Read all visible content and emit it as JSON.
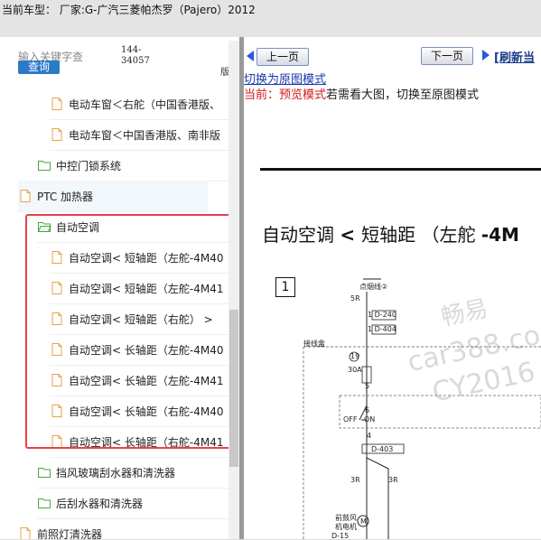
{
  "header": {
    "title": "当前车型： 厂家:G-广汽三菱帕杰罗（Pajero）2012"
  },
  "search": {
    "placeholder": "输入关键字查",
    "button_label": "查询",
    "code_line1": "144-",
    "code_line2": "34057",
    "code_mark": "版"
  },
  "tree": [
    {
      "label": "电动车窗＜右舵（中国香港版、",
      "type": "file"
    },
    {
      "label": "电动车窗＜中国香港版、南非版",
      "type": "file"
    },
    {
      "label": "中控门锁系统",
      "type": "folder"
    },
    {
      "label": "PTC 加热器",
      "type": "file"
    },
    {
      "label": "自动空调",
      "type": "folder-open"
    },
    {
      "label": "自动空调< 短轴距（左舵-4M40",
      "type": "file"
    },
    {
      "label": "自动空调< 短轴距（左舵-4M41",
      "type": "file"
    },
    {
      "label": "自动空调< 短轴距（右舵） >",
      "type": "file"
    },
    {
      "label": "自动空调< 长轴距（左舵-4M40",
      "type": "file"
    },
    {
      "label": "自动空调< 长轴距（左舵-4M41",
      "type": "file"
    },
    {
      "label": "自动空调< 长轴距（右舵-4M40",
      "type": "file"
    },
    {
      "label": "自动空调< 长轴距（右舵-4M41",
      "type": "file"
    },
    {
      "label": "挡风玻璃刮水器和清洗器",
      "type": "folder"
    },
    {
      "label": "后刮水器和清洗器",
      "type": "folder"
    },
    {
      "label": "前照灯清洗器",
      "type": "file"
    }
  ],
  "toolbar": {
    "prev_label": "上一页",
    "next_label": "下一页",
    "refresh_label": "[刷新当"
  },
  "viewer": {
    "switch_link": "切换为原图模式",
    "mode_prefix": "当前：预览模式",
    "mode_suffix": "若需看大图，切换至原图模式",
    "diagram_title_a": "自动空调 ",
    "diagram_title_b": "< ",
    "diagram_title_c": "短轴距 （左舵 ",
    "diagram_title_d": "-4M",
    "box_number": "1",
    "labels": {
      "ignition": "点烟线②",
      "wire_5r": "5R",
      "d240": "1 D-240",
      "d404": "1 D-404",
      "junction_box": "接线盒",
      "fuse_no": "19",
      "fuse_amp": "30A",
      "pin5": "5",
      "pin6": "6",
      "off": "OFF",
      "on": "ON",
      "pin4": "4",
      "d403": "D-403",
      "wire_3r_a": "3R",
      "wire_3r_b": "3R",
      "blower_1": "前鼓风",
      "blower_2": "机电机",
      "d15": "D-15"
    },
    "watermark_1": "畅易",
    "watermark_2": "car388.com",
    "watermark_3": "CY2016"
  },
  "colors": {
    "highlight_border": "#e8404c",
    "button_blue": "#2a7ac7",
    "mode_red": "#d11a1a",
    "folder_green": "#4aa34a",
    "file_orange": "#e8a24a"
  }
}
